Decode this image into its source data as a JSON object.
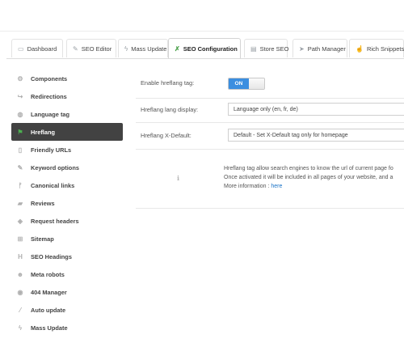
{
  "tabs": [
    {
      "label": "Dashboard",
      "icon": "dashboard-icon",
      "glyph": "▭"
    },
    {
      "label": "SEO Editor",
      "icon": "edit-icon",
      "glyph": "✎"
    },
    {
      "label": "Mass Update",
      "icon": "bolt-icon",
      "glyph": "ϟ"
    },
    {
      "label": "SEO Configuration",
      "icon": "wrench-icon",
      "glyph": "✗",
      "active": true
    },
    {
      "label": "Store SEO",
      "icon": "store-icon",
      "glyph": "▤"
    },
    {
      "label": "Path Manager",
      "icon": "path-icon",
      "glyph": "➤"
    },
    {
      "label": "Rich Snippets",
      "icon": "thumb-icon",
      "glyph": "☝"
    }
  ],
  "sidebar": {
    "items": [
      {
        "label": "Components",
        "icon": "gear-icon",
        "glyph": "⚙"
      },
      {
        "label": "Redirections",
        "icon": "redirect-icon",
        "glyph": "↪"
      },
      {
        "label": "Language tag",
        "icon": "globe-icon",
        "glyph": "◍"
      },
      {
        "label": "Hreflang",
        "icon": "flag-icon",
        "glyph": "⚑",
        "active": true
      },
      {
        "label": "Friendly URLs",
        "icon": "file-icon",
        "glyph": "▯"
      },
      {
        "label": "Keyword options",
        "icon": "edit-icon",
        "glyph": "✎"
      },
      {
        "label": "Canonical links",
        "icon": "canonical-icon",
        "glyph": "ᚠ"
      },
      {
        "label": "Reviews",
        "icon": "comment-icon",
        "glyph": "▰"
      },
      {
        "label": "Request headers",
        "icon": "headers-icon",
        "glyph": "◈"
      },
      {
        "label": "Sitemap",
        "icon": "sitemap-icon",
        "glyph": "⊞"
      },
      {
        "label": "SEO Headings",
        "icon": "heading-icon",
        "glyph": "H"
      },
      {
        "label": "Meta robots",
        "icon": "robot-icon",
        "glyph": "☻"
      },
      {
        "label": "404 Manager",
        "icon": "eye-icon",
        "glyph": "◉"
      },
      {
        "label": "Auto update",
        "icon": "magic-icon",
        "glyph": "⁄"
      },
      {
        "label": "Mass Update",
        "icon": "bolt-icon",
        "glyph": "ϟ"
      }
    ]
  },
  "form": {
    "enable_label": "Enable hreflang tag:",
    "toggle_on": "ON",
    "lang_display_label": "Hreflang lang display:",
    "lang_display_value": "Language only (en, fr, de)",
    "xdefault_label": "Hreflang X-Default:",
    "xdefault_value": "Default - Set X-Default tag only for homepage"
  },
  "help": {
    "line1": "Hreflang tag allow search engines to know the url of current page fo",
    "line2": "Once activated it will be included in all pages of your website, and a",
    "line3_prefix": "More information : ",
    "link": "here",
    "icon": "info-icon"
  }
}
